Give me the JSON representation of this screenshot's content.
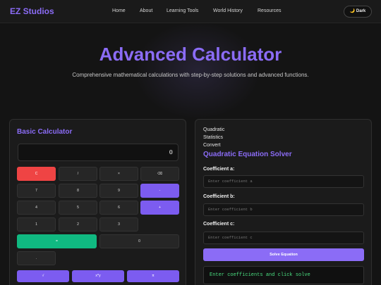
{
  "nav": {
    "logo": "EZ Studios",
    "links": [
      "Home",
      "About",
      "Learning Tools",
      "World History",
      "Resources"
    ],
    "theme_icon": "moon-icon",
    "theme_label": "🌙 Dark"
  },
  "hero": {
    "title": "Advanced Calculator",
    "subtitle": "Comprehensive mathematical calculations with step-by-step solutions and advanced functions."
  },
  "basic": {
    "title": "Basic Calculator",
    "display": "0",
    "keys": {
      "clear": "C",
      "divide": "/",
      "multiply": "×",
      "backspace": "⌫",
      "seven": "7",
      "eight": "8",
      "nine": "9",
      "minus": "-",
      "four": "4",
      "five": "5",
      "six": "6",
      "plus": "+",
      "one": "1",
      "two": "2",
      "three": "3",
      "equals": "=",
      "zero": "0",
      "dot": ".",
      "sqrt": "√",
      "power": "x^y",
      "pi": "π"
    }
  },
  "solver": {
    "modes": [
      "Quadratic",
      "Statistics",
      "Convert"
    ],
    "title": "Quadratic Equation Solver",
    "coef_a_label": "Coefficient a:",
    "coef_a_placeholder": "Enter coefficient a",
    "coef_b_label": "Coefficient b:",
    "coef_b_placeholder": "Enter coefficient b",
    "coef_c_label": "Coefficient c:",
    "coef_c_placeholder": "Enter coefficient c",
    "solve_label": "Solve Equation",
    "result_text": "Enter coefficients and click solve"
  },
  "colors": {
    "accent": "#8b6cf6",
    "danger": "#ef4444",
    "success": "#10b981",
    "result_text": "#4ade80"
  }
}
